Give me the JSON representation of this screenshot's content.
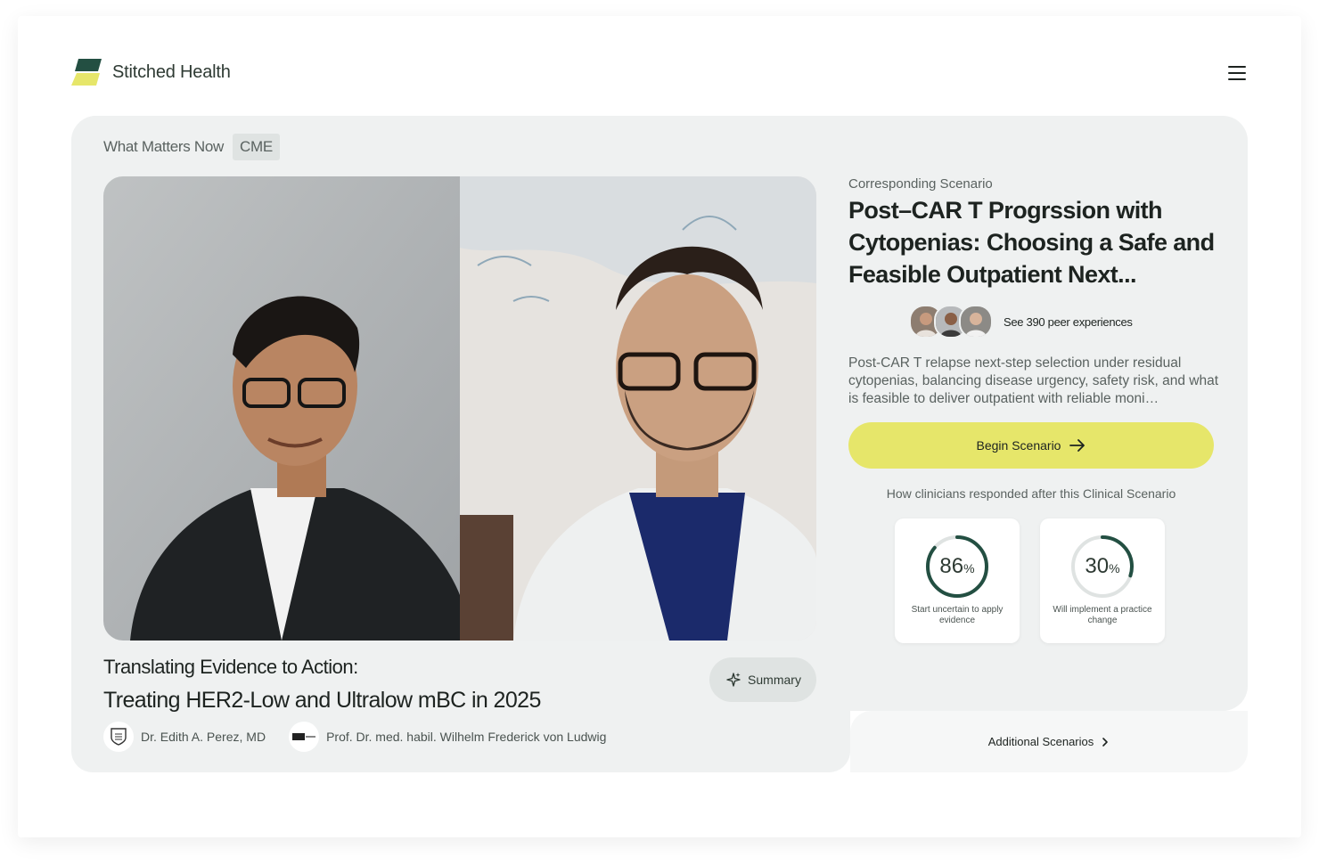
{
  "brand": {
    "name": "Stitched Health",
    "logo_icon": "stitched-health-logo",
    "accent": "#e6e66a",
    "dark_green": "#234f42"
  },
  "header": {
    "menu_icon": "hamburger-menu-icon"
  },
  "section": {
    "title": "What Matters Now",
    "badge": "CME"
  },
  "video": {
    "thumbnail": "two-speaker-video-call"
  },
  "talk": {
    "title": "Translating Evidence to Action:",
    "subtitle": "Treating HER2-Low and Ultralow mBC in 2025",
    "summary_label": "Summary",
    "speakers": [
      {
        "name": "Dr. Edith A. Perez, MD",
        "logo": "mayo-clinic-logo"
      },
      {
        "name": "Prof. Dr. med. habil. Wilhelm Frederick von Ludwig",
        "logo": "institution-logo"
      }
    ]
  },
  "scenario": {
    "label": "Corresponding Scenario",
    "title": "Post–CAR T Progrssion with Cytopenias: Choosing a Safe and Feasible Outpatient Next...",
    "peers_label": "See 390 peer experiences",
    "description": "Post-CAR T relapse next-step selection under residual cytopenias, balancing disease urgency, safety risk, and what is feasible to deliver outpatient with reliable moni…",
    "begin_label": "Begin Scenario",
    "responded_label": "How clinicians responded after this Clinical Scenario",
    "stats": [
      {
        "value": "86",
        "unit": "%",
        "fraction": 0.86,
        "label": "Start uncertain to apply evidence"
      },
      {
        "value": "30",
        "unit": "%",
        "fraction": 0.3,
        "label": "Will implement a practice change"
      }
    ],
    "additional_label": "Additional Scenarios"
  }
}
